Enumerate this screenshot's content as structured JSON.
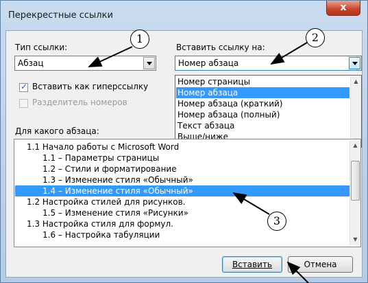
{
  "window": {
    "title": "Перекрестные ссылки",
    "close_glyph": "x"
  },
  "ref_type": {
    "label": "Тип ссылки:",
    "value": "Абзац"
  },
  "insert_ref": {
    "label": "Вставить ссылку на:",
    "value": "Номер абзаца",
    "options": [
      "Номер страницы",
      "Номер абзаца",
      "Номер абзаца (краткий)",
      "Номер абзаца (полный)",
      "Текст абзаца",
      "Выше/ниже"
    ],
    "selected_index": 1
  },
  "hyperlink_checkbox": {
    "label": "Вставить как гиперссылку",
    "checked": true
  },
  "separator_checkbox": {
    "label": "Разделитель номеров",
    "checked": false
  },
  "paragraph_list": {
    "label": "Для какого абзаца:",
    "items": [
      "1.1 Начало работы с Microsoft Word",
      "1.1 – Параметры страницы",
      "1.2 – Стили и форматирование",
      "1.3 – Изменение стиля «Обычный»",
      "1.4 – Изменение стиля «Обычный»",
      "1.2 Настройка стилей для рисунков.",
      "1.5 – Изменение стиля «Рисунки»",
      "1.3 Настройка стиля для формул.",
      "1.6 – Настройка табуляции"
    ],
    "selected_index": 4
  },
  "buttons": {
    "insert": "Вставить",
    "cancel": "Отмена"
  },
  "callouts": [
    "1",
    "2",
    "3"
  ],
  "colors": {
    "selection": "#3399ff",
    "close_button": "#c5432b"
  }
}
